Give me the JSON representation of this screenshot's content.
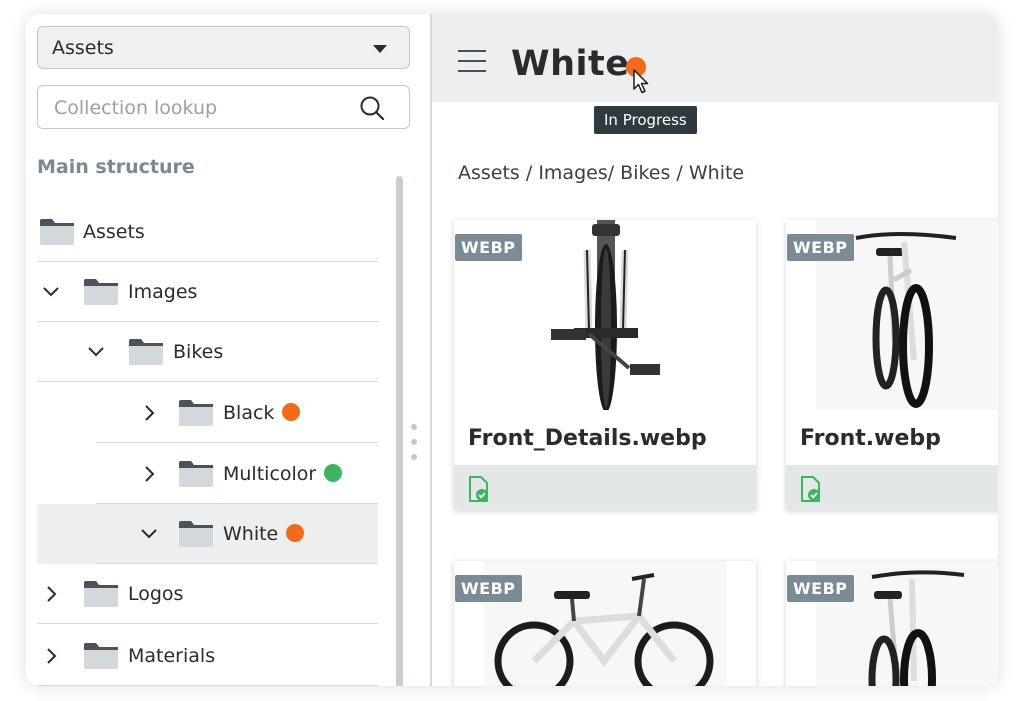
{
  "sidebar": {
    "collection_select": {
      "value": "Assets"
    },
    "search": {
      "placeholder": "Collection lookup"
    },
    "section_title": "Main structure",
    "tree": [
      {
        "label": "Assets",
        "expand": "none"
      },
      {
        "label": "Images",
        "expand": "expanded"
      },
      {
        "label": "Bikes",
        "expand": "expanded"
      },
      {
        "label": "Black",
        "expand": "collapsed",
        "status": "in-progress"
      },
      {
        "label": "Multicolor",
        "expand": "collapsed",
        "status": "done"
      },
      {
        "label": "White",
        "expand": "expanded",
        "status": "in-progress",
        "selected": true
      },
      {
        "label": "Logos",
        "expand": "collapsed"
      },
      {
        "label": "Materials",
        "expand": "collapsed"
      }
    ]
  },
  "header": {
    "title": "White",
    "status": "in-progress",
    "tooltip": "In Progress"
  },
  "breadcrumb": "Assets / Images/ Bikes / White",
  "assets": [
    {
      "badge": "WEBP",
      "name": "Front_Details.webp",
      "footer_icon": "file-check-icon"
    },
    {
      "badge": "WEBP",
      "name": "Front.webp",
      "footer_icon": "file-check-icon"
    },
    {
      "badge": "WEBP",
      "name": ""
    },
    {
      "badge": "WEBP",
      "name": ""
    }
  ],
  "colors": {
    "in_progress": "#f26b1d",
    "done": "#3cb55e",
    "badge_bg": "#7a8b96",
    "section_title": "#7a8994",
    "check_icon": "#3cb55e"
  },
  "icons": {
    "collection_caret": "caret-down-icon",
    "search": "search-icon",
    "menu": "hamburger-menu-icon",
    "folder": "folder-icon",
    "chevron_expanded": "chevron-down-icon",
    "chevron_collapsed": "chevron-right-icon",
    "resize_handle": "drag-handle-icon",
    "cursor": "mouse-cursor-icon"
  }
}
